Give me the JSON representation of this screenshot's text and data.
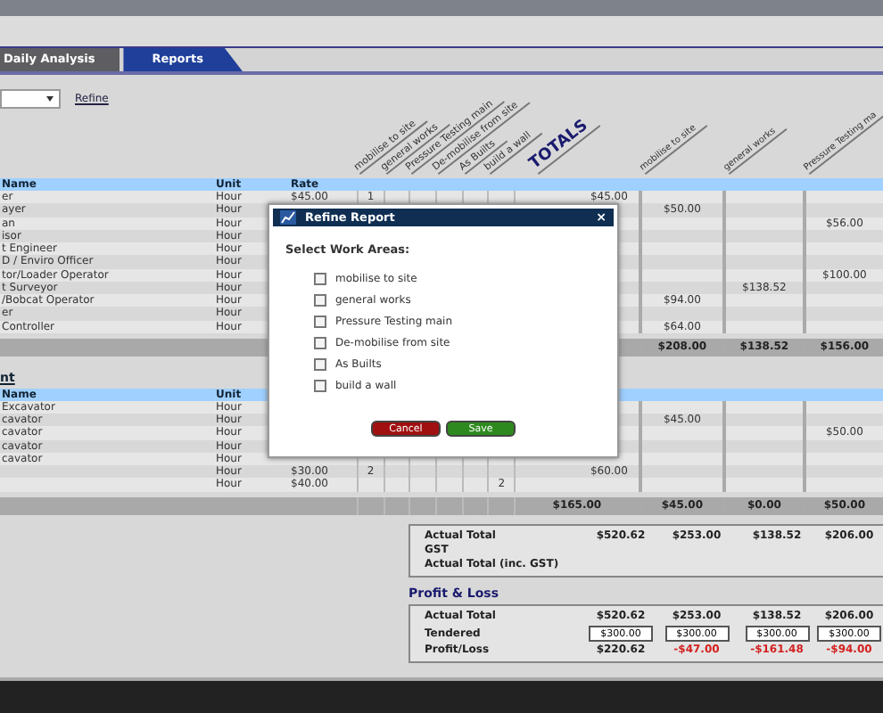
{
  "tabs": [
    {
      "label": "Daily Analysis",
      "selected": false
    },
    {
      "label": "Reports",
      "selected": true
    }
  ],
  "toolbar": {
    "refine_link": "Refine"
  },
  "columns": {
    "small": [
      "mobilise to site",
      "general works",
      "Pressure Testing main",
      "De-mobilise from site",
      "As Builts",
      "build a wall"
    ],
    "totals": "TOTALS",
    "big": [
      "mobilise to site",
      "general works",
      "Pressure Testing ma"
    ]
  },
  "sections": [
    {
      "header": {
        "name": "Name",
        "unit": "Unit",
        "rate": "Rate"
      },
      "rows": [
        {
          "name": "er",
          "unit": "Hour",
          "rate": "$45.00",
          "cells": {
            "small_1": "1",
            "total": "$45.00"
          }
        },
        {
          "name": "ayer",
          "unit": "Hour",
          "cells": {
            "big_1": "$50.00"
          }
        },
        {
          "name": "an",
          "unit": "Hour",
          "cells": {
            "big_3": "$56.00"
          }
        },
        {
          "name": "isor",
          "unit": "Hour"
        },
        {
          "name": "t Engineer",
          "unit": "Hour"
        },
        {
          "name": "D / Enviro Officer",
          "unit": "Hour"
        },
        {
          "name": "tor/Loader Operator",
          "unit": "Hour",
          "cells": {
            "big_3": "$100.00"
          }
        },
        {
          "name": "t Surveyor",
          "unit": "Hour",
          "cells": {
            "big_2": "$138.52"
          }
        },
        {
          "name": "/Bobcat Operator",
          "unit": "Hour",
          "cells": {
            "big_1": "$94.00"
          }
        },
        {
          "name": "er",
          "unit": "Hour"
        },
        {
          "name": " Controller",
          "unit": "Hour",
          "cells": {
            "big_1": "$64.00"
          }
        }
      ],
      "subtotal": {
        "big_1": "$208.00",
        "big_2": "$138.52",
        "big_3": "$156.00"
      }
    },
    {
      "title": "nt",
      "header": {
        "name": "Name",
        "unit": "Unit"
      },
      "rows": [
        {
          "name": "Excavator",
          "unit": "Hour"
        },
        {
          "name": "cavator",
          "unit": "Hour",
          "cells": {
            "big_1": "$45.00"
          }
        },
        {
          "name": "cavator",
          "unit": "Hour",
          "cells": {
            "big_3": "$50.00"
          }
        },
        {
          "name": "cavator",
          "unit": "Hour"
        },
        {
          "name": "cavator",
          "unit": "Hour"
        },
        {
          "unit": "Hour",
          "rate": "$30.00",
          "cells": {
            "small_1": "2",
            "total": "$60.00"
          }
        },
        {
          "unit": "Hour",
          "rate": "$40.00",
          "cells": {
            "small_6": "2"
          }
        }
      ],
      "subtotal": {
        "total": "$165.00",
        "big_1": "$45.00",
        "big_2": "$0.00",
        "big_3": "$50.00"
      }
    }
  ],
  "summary": [
    {
      "label": "Actual Total",
      "values": [
        "$520.62",
        "$253.00",
        "$138.52",
        "$206.00"
      ]
    },
    {
      "label": "GST"
    },
    {
      "label": "Actual Total (inc. GST)"
    }
  ],
  "profit_loss": {
    "title": "Profit & Loss",
    "actual": {
      "label": "Actual Total",
      "values": [
        "$520.62",
        "$253.00",
        "$138.52",
        "$206.00"
      ]
    },
    "tendered": {
      "label": "Tendered",
      "values": [
        "$300.00",
        "$300.00",
        "$300.00",
        "$300.00"
      ]
    },
    "result": {
      "label": "Profit/Loss",
      "values": [
        {
          "text": "$220.62",
          "loss": false
        },
        {
          "text": "-$47.00",
          "loss": true
        },
        {
          "text": "-$161.48",
          "loss": true
        },
        {
          "text": "-$94.00",
          "loss": true
        }
      ]
    }
  },
  "dialog": {
    "title": "Refine Report",
    "close": "×",
    "prompt": "Select Work Areas:",
    "options": [
      {
        "label": "mobilise to site",
        "checked": false
      },
      {
        "label": "general works",
        "checked": false
      },
      {
        "label": "Pressure Testing main",
        "checked": false
      },
      {
        "label": "De-mobilise from site",
        "checked": false
      },
      {
        "label": "As Builts",
        "checked": false
      },
      {
        "label": "build a wall",
        "checked": false
      }
    ],
    "buttons": [
      {
        "label": "Cancel",
        "kind": "cancel"
      },
      {
        "label": "Save",
        "kind": "save"
      }
    ]
  }
}
